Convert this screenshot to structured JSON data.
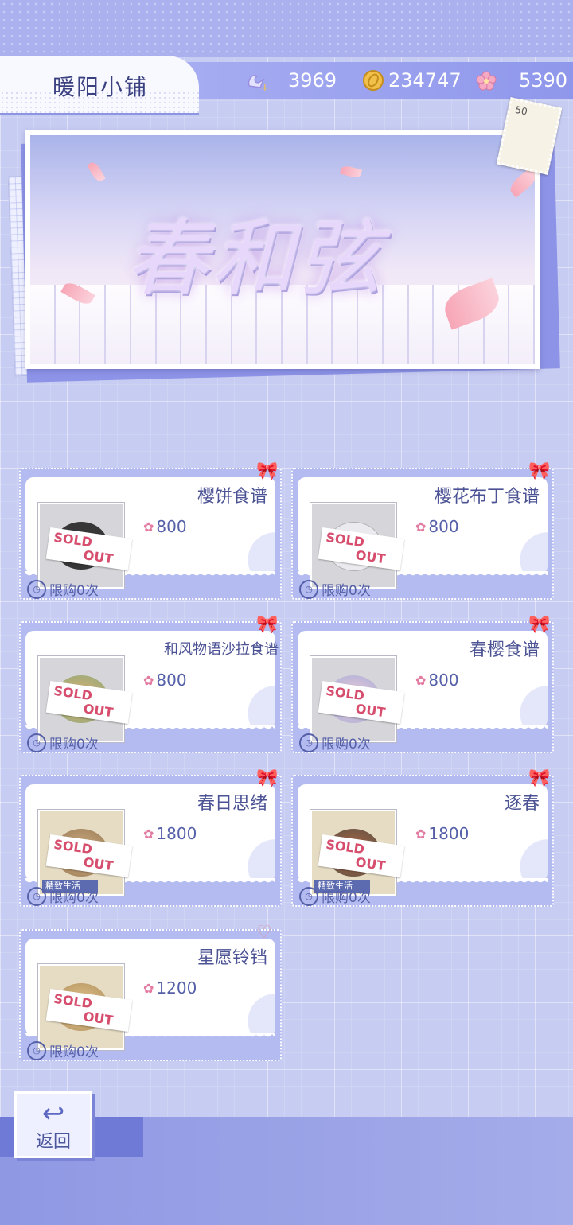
{
  "header": {
    "shop_title": "暖阳小铺",
    "currencies": [
      {
        "icon": "swan-plus-icon",
        "value": "3969"
      },
      {
        "icon": "gold-coin-icon",
        "value": "234747"
      },
      {
        "icon": "sakura-ticket-icon",
        "value": "5390"
      }
    ]
  },
  "banner": {
    "title": "春和弦",
    "stamp_value": "50"
  },
  "items": [
    {
      "name": "樱饼食谱",
      "price": "800",
      "status": "SOLD OUT",
      "limit": "限购0次",
      "tag": ""
    },
    {
      "name": "樱花布丁食谱",
      "price": "800",
      "status": "SOLD OUT",
      "limit": "限购0次",
      "tag": ""
    },
    {
      "name": "和风物语沙拉食谱",
      "price": "800",
      "status": "SOLD OUT",
      "limit": "限购0次",
      "tag": ""
    },
    {
      "name": "春樱食谱",
      "price": "800",
      "status": "SOLD OUT",
      "limit": "限购0次",
      "tag": ""
    },
    {
      "name": "春日思绪",
      "price": "1800",
      "status": "SOLD OUT",
      "limit": "限购0次",
      "tag": "精致生活"
    },
    {
      "name": "逐春",
      "price": "1800",
      "status": "SOLD OUT",
      "limit": "限购0次",
      "tag": "精致生活"
    },
    {
      "name": "星愿铃铛",
      "price": "1200",
      "status": "SOLD OUT",
      "limit": "限购0次",
      "tag": ""
    }
  ],
  "sold_out": {
    "line1": "SOLD",
    "line2": "OUT"
  },
  "back_button": {
    "label": "返回"
  },
  "colors": {
    "accent": "#8f97ec",
    "text": "#4c5394",
    "sold_out": "#d64d6d"
  }
}
